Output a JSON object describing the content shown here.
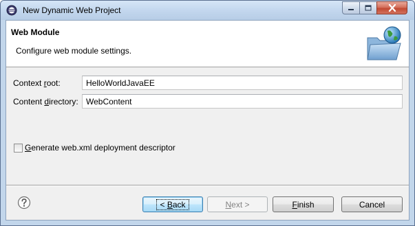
{
  "window": {
    "title": "New Dynamic Web Project",
    "controls": {
      "minimize": "minimize",
      "maximize": "maximize",
      "close": "close"
    }
  },
  "banner": {
    "title": "Web Module",
    "description": "Configure web module settings.",
    "image_icon": "folder-globe-icon"
  },
  "form": {
    "context_root": {
      "label_prefix": "Context ",
      "label_mnemonic": "r",
      "label_suffix": "oot:",
      "value": "HelloWorldJavaEE"
    },
    "content_directory": {
      "label_prefix": "Content ",
      "label_mnemonic": "d",
      "label_suffix": "irectory:",
      "value": "WebContent"
    },
    "generate_web_xml": {
      "label_mnemonic": "G",
      "label_suffix": "enerate web.xml deployment descriptor",
      "checked": false
    }
  },
  "footer": {
    "help_icon": "help-icon",
    "back": {
      "prefix": "< ",
      "mnemonic": "B",
      "suffix": "ack"
    },
    "next": {
      "mnemonic": "N",
      "suffix": "ext >"
    },
    "finish": {
      "mnemonic": "F",
      "suffix": "inish"
    },
    "cancel": {
      "label": "Cancel"
    }
  },
  "colors": {
    "title_bar": "#c3d7ee",
    "close_button": "#c24a33",
    "default_button_border": "#3c7fb1"
  }
}
